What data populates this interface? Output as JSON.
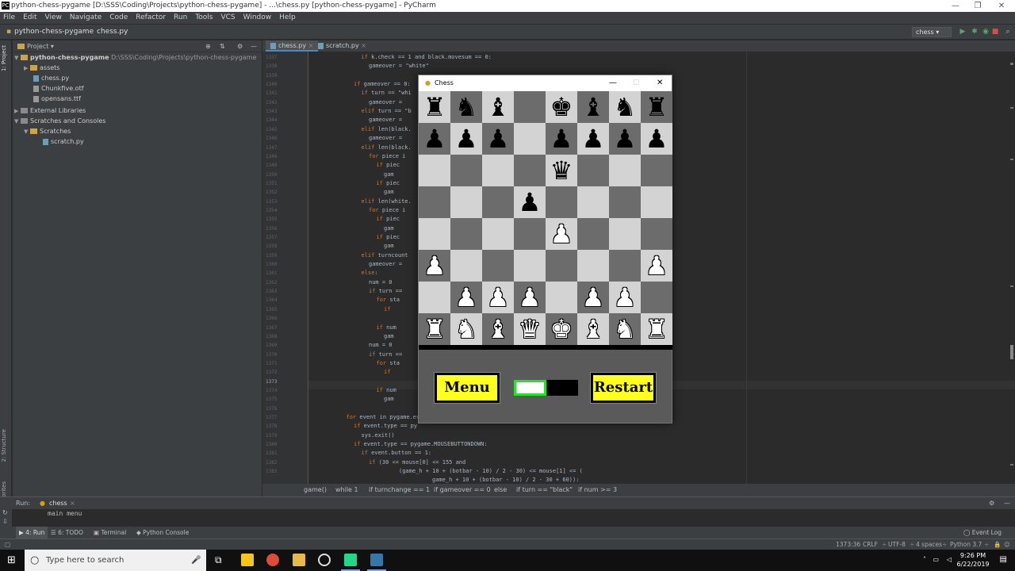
{
  "window": {
    "title": "python-chess-pygame [D:\\SSS\\Coding\\Projects\\python-chess-pygame] - ...\\chess.py [python-chess-pygame] - PyCharm"
  },
  "menu": [
    "File",
    "Edit",
    "View",
    "Navigate",
    "Code",
    "Refactor",
    "Run",
    "Tools",
    "VCS",
    "Window",
    "Help"
  ],
  "navbar": {
    "project": "python-chess-pygame",
    "file": "chess.py",
    "run_config": "chess"
  },
  "left_strip": {
    "project": "1: Project",
    "structure": "2: Structure",
    "favorites": "2: Favorites"
  },
  "project_panel": {
    "header": "Project",
    "root_name": "python-chess-pygame",
    "root_path": "D:\\SSS\\Coding\\Projects\\python-chess-pygame",
    "items": [
      "assets",
      "chess.py",
      "Chunkfive.otf",
      "opensans.ttf"
    ],
    "external": "External Libraries",
    "scratches": "Scratches and Consoles",
    "scratches_folder": "Scratches",
    "scratch_file": "scratch.py"
  },
  "editor": {
    "tabs": [
      "chess.py",
      "scratch.py"
    ],
    "line_numbers": [
      "1337",
      "1338",
      "1339",
      "1340",
      "1341",
      "1342",
      "1343",
      "1344",
      "1345",
      "1346",
      "1347",
      "1348",
      "1349",
      "1350",
      "1351",
      "1352",
      "1353",
      "1354",
      "1355",
      "1356",
      "1357",
      "1358",
      "1359",
      "1360",
      "1361",
      "1362",
      "1363",
      "1364",
      "1365",
      "1366",
      "1367",
      "1368",
      "1369",
      "1370",
      "1371",
      "1372",
      "1373",
      "1374",
      "1375",
      "1376",
      "1377",
      "1378",
      "1379",
      "1380",
      "1381",
      "1382",
      "1383"
    ],
    "code_right": [
      {
        "indent": 7,
        "kw": "if",
        "text": " k.check == 1 and black.movesum == 0:"
      },
      {
        "indent": 8,
        "kw": "",
        "text": "gameover = \"white\""
      },
      {
        "indent": 0,
        "kw": "",
        "text": ""
      },
      {
        "indent": 6,
        "kw": "if",
        "text": " gameover == 0:"
      },
      {
        "indent": 7,
        "kw": "if",
        "text": " turn == \"whi"
      },
      {
        "indent": 8,
        "kw": "",
        "text": "gameover ="
      },
      {
        "indent": 7,
        "kw": "elif",
        "text": " turn == \"b"
      },
      {
        "indent": 8,
        "kw": "",
        "text": "gameover ="
      },
      {
        "indent": 7,
        "kw": "elif",
        "text": " len(black."
      },
      {
        "indent": 8,
        "kw": "",
        "text": "gameover ="
      },
      {
        "indent": 7,
        "kw": "elif",
        "text": " len(black."
      },
      {
        "indent": 8,
        "kw": "for",
        "text": " piece i"
      },
      {
        "indent": 9,
        "kw": "if",
        "text": " piec"
      },
      {
        "indent": 10,
        "kw": "",
        "text": "gam"
      },
      {
        "indent": 9,
        "kw": "if",
        "text": " piec"
      },
      {
        "indent": 10,
        "kw": "",
        "text": "gam"
      },
      {
        "indent": 7,
        "kw": "elif",
        "text": " len(white."
      },
      {
        "indent": 8,
        "kw": "for",
        "text": " piece i"
      },
      {
        "indent": 9,
        "kw": "if",
        "text": " piec"
      },
      {
        "indent": 10,
        "kw": "",
        "text": "gam"
      },
      {
        "indent": 9,
        "kw": "if",
        "text": " piec"
      },
      {
        "indent": 10,
        "kw": "",
        "text": "gam"
      },
      {
        "indent": 7,
        "kw": "elif",
        "text": " turncount"
      },
      {
        "indent": 8,
        "kw": "",
        "text": "gameover ="
      },
      {
        "indent": 7,
        "kw": "else",
        "text": ":"
      },
      {
        "indent": 8,
        "kw": "",
        "text": "num = 0"
      },
      {
        "indent": 8,
        "kw": "if",
        "text": " turn =="
      },
      {
        "indent": 9,
        "kw": "for",
        "text": " sta"
      },
      {
        "indent": 10,
        "kw": "if",
        "text": ""
      },
      {
        "indent": 0,
        "kw": "",
        "text": ""
      },
      {
        "indent": 9,
        "kw": "if",
        "text": " num"
      },
      {
        "indent": 10,
        "kw": "",
        "text": "gam"
      },
      {
        "indent": 8,
        "kw": "",
        "text": "num = 0"
      },
      {
        "indent": 8,
        "kw": "if",
        "text": " turn =="
      },
      {
        "indent": 9,
        "kw": "for",
        "text": " sta"
      },
      {
        "indent": 10,
        "kw": "if",
        "text": ""
      },
      {
        "indent": 0,
        "kw": "",
        "text": ""
      },
      {
        "indent": 9,
        "kw": "if",
        "text": " num"
      },
      {
        "indent": 10,
        "kw": "",
        "text": "gam"
      },
      {
        "indent": 0,
        "kw": "",
        "text": ""
      },
      {
        "indent": 5,
        "kw": "for",
        "text": " event in pygame.event"
      },
      {
        "indent": 6,
        "kw": "if",
        "text": " event.type == py"
      },
      {
        "indent": 7,
        "kw": "",
        "text": "sys.exit()"
      },
      {
        "indent": 6,
        "kw": "if",
        "text": " event.type == pygame.MOUSEBUTTONDOWN:"
      },
      {
        "indent": 7,
        "kw": "if",
        "text": " event.button == 1:"
      },
      {
        "indent": 8,
        "kw": "if",
        "text": " (30 <= mouse[0] <= 155 and"
      },
      {
        "indent": 12,
        "kw": "",
        "text": "(game_h + 10 + (botbar - 10) / 2 - 30) <= mouse[1] <= ("
      }
    ],
    "code_last": "game_h + 10 + (botbar - 10) / 2 - 30 + 60)):",
    "code_cut": "menu()",
    "breadcrumbs": [
      "game()",
      "while 1",
      "if turnchange == 1",
      "if gameover == 0",
      "else",
      "if turn == \"black\"",
      "if num >= 3"
    ]
  },
  "chess": {
    "title": "Chess",
    "menu_label": "Menu",
    "restart_label": "Restart",
    "timer_fraction": 0.5,
    "colors": {
      "light": "#d3d3d3",
      "dark": "#6c6c6c",
      "button": "#ffff1f",
      "timer": "#27e227"
    },
    "board": [
      [
        "bR",
        "bN",
        "bB",
        "",
        "bK",
        "bB",
        "bN",
        "bR"
      ],
      [
        "bP",
        "bP",
        "bP",
        "",
        "bP",
        "bP",
        "bP",
        "bP"
      ],
      [
        "",
        "",
        "",
        "",
        "bQ",
        "",
        "",
        ""
      ],
      [
        "",
        "",
        "",
        "bP",
        "",
        "",
        "",
        ""
      ],
      [
        "",
        "",
        "",
        "",
        "wP",
        "",
        "",
        ""
      ],
      [
        "wP",
        "",
        "",
        "",
        "",
        "",
        "",
        "wP"
      ],
      [
        "",
        "wP",
        "wP",
        "wP",
        "",
        "wP",
        "wP",
        ""
      ],
      [
        "wR",
        "wN",
        "wB",
        "wQ",
        "wK",
        "wB",
        "wN",
        "wR"
      ]
    ]
  },
  "run_panel": {
    "label": "Run:",
    "config": "chess",
    "output": "main menu"
  },
  "bottom_tabs": [
    "4: Run",
    "6: TODO",
    "Terminal",
    "Python Console"
  ],
  "event_log": "Event Log",
  "status": {
    "position": "1373:36",
    "line_sep": "CRLF",
    "encoding": "UTF-8",
    "indent": "4 spaces",
    "interpreter": "Python 3.7"
  },
  "taskbar": {
    "search_placeholder": "Type here to search",
    "time": "9:26 PM",
    "date": "6/22/2019"
  }
}
